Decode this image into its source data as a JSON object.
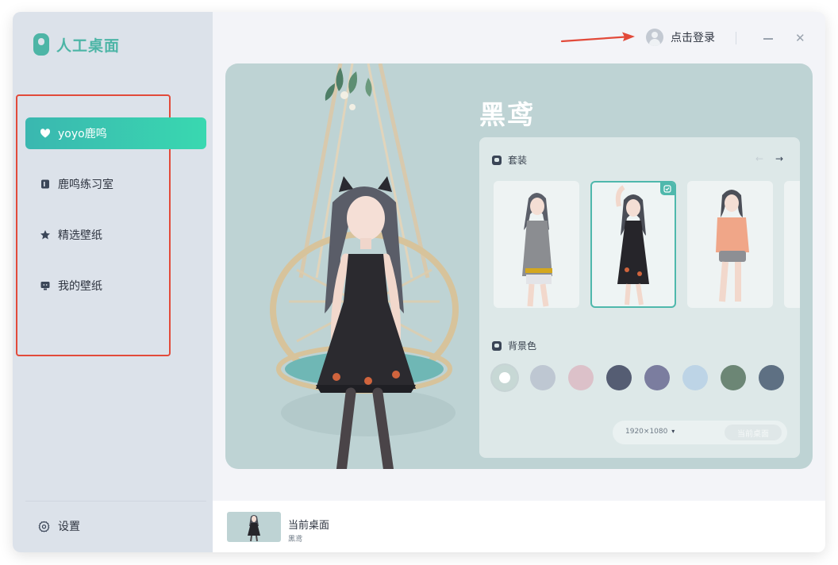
{
  "app": {
    "logo_text": "人工桌面",
    "brand_color": "#4db5a6",
    "accent_gradient": [
      "#3ab7b0",
      "#39d8b0"
    ]
  },
  "sidebar": {
    "items": [
      {
        "label": "yoyo鹿鸣",
        "icon": "heart-icon",
        "active": true
      },
      {
        "label": "鹿鸣练习室",
        "icon": "door-icon",
        "active": false
      },
      {
        "label": "精选壁纸",
        "icon": "star-icon",
        "active": false
      },
      {
        "label": "我的壁纸",
        "icon": "monitor-icon",
        "active": false
      }
    ],
    "settings_label": "设置",
    "settings_icon": "gear-icon"
  },
  "header": {
    "login_label": "点击登录",
    "minimize_icon": "minimize-icon",
    "close_icon": "close-icon"
  },
  "hero": {
    "skin_name": "黑鸢",
    "outfits": {
      "title": "套装",
      "items": [
        {
          "name": "outfit-grey-hoodie",
          "selected": false
        },
        {
          "name": "outfit-black-dress",
          "selected": true
        },
        {
          "name": "outfit-peach-tee",
          "selected": false
        }
      ]
    },
    "background": {
      "title": "背景色",
      "swatches": [
        "#c7d8d5",
        "#bec7d2",
        "#dcc1c9",
        "#555d73",
        "#7b7d9f",
        "#bdd4e6",
        "#6c8675",
        "#5e7083"
      ],
      "selected_index": 0
    },
    "resolution": "1920×1080",
    "apply_label": "当前桌面"
  },
  "bottom": {
    "current_label": "当前桌面",
    "current_name": "黑鸢"
  }
}
